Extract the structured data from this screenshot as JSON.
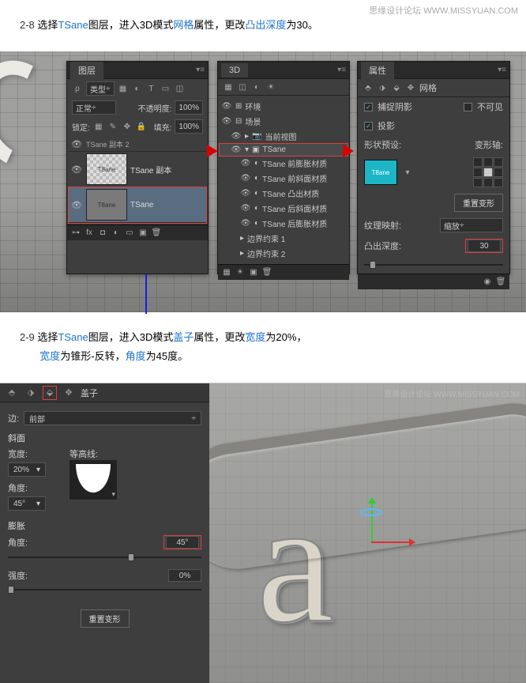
{
  "watermark": {
    "site": "思缘设计论坛",
    "url": "WWW.MISSYUAN.COM"
  },
  "step28": {
    "num": "2-8",
    "t1": "选择",
    "layer": "TSane",
    "t2": "图层，进入3D模式",
    "attr": "网格",
    "t3": "属性，更改",
    "field": "凸出深度",
    "t4": "为30。"
  },
  "step29": {
    "num": "2-9",
    "t1": "选择",
    "layer": "TSane",
    "t2": "图层，进入3D模式",
    "attr": "盖子",
    "t3": "属性，更改",
    "field": "宽度",
    "t4": "为20%，",
    "line2_a": "宽度",
    "line2_b": "为锥形-反转，",
    "line2_c": "角度",
    "line2_d": "为45度。"
  },
  "layers_panel": {
    "title": "图层",
    "kind": "类型",
    "blend": "正常",
    "opacity_label": "不透明度:",
    "opacity": "100%",
    "lock": "锁定:",
    "fill_label": "填充:",
    "fill": "100%",
    "l1": "TSane 副本 2",
    "l2": "TSane 副本",
    "l3": "TSane",
    "thumb_t": "T8ane"
  },
  "panel3d": {
    "title": "3D",
    "env": "环境",
    "scene": "场景",
    "view": "当前视图",
    "tsane": "TSane",
    "m1": "TSane 前膨胀材质",
    "m2": "TSane 前斜面材质",
    "m3": "TSane 凸出材质",
    "m4": "TSane 后斜面材质",
    "m5": "TSane 后膨胀材质",
    "c1": "边界约束 1",
    "c2": "边界约束 2"
  },
  "prop": {
    "title": "属性",
    "sub": "网格",
    "catch": "捕捉阴影",
    "invisible": "不可见",
    "cast": "投影",
    "shape": "形状预设:",
    "axis": "变形轴:",
    "reset": "重置变形",
    "texmap": "纹理映射:",
    "texval": "缩放",
    "depth": "凸出深度:",
    "depth_val": "30"
  },
  "cap": {
    "tab": "盖子",
    "edge_label": "边:",
    "edge": "前部",
    "bevel": "斜面",
    "width_l": "宽度:",
    "width": "20%",
    "contour_l": "等高线:",
    "angle_l": "角度:",
    "angle1": "45°",
    "inflate": "膨胀",
    "angle2": "45°",
    "strength_l": "强度:",
    "strength": "0%",
    "reset": "重置变形"
  }
}
